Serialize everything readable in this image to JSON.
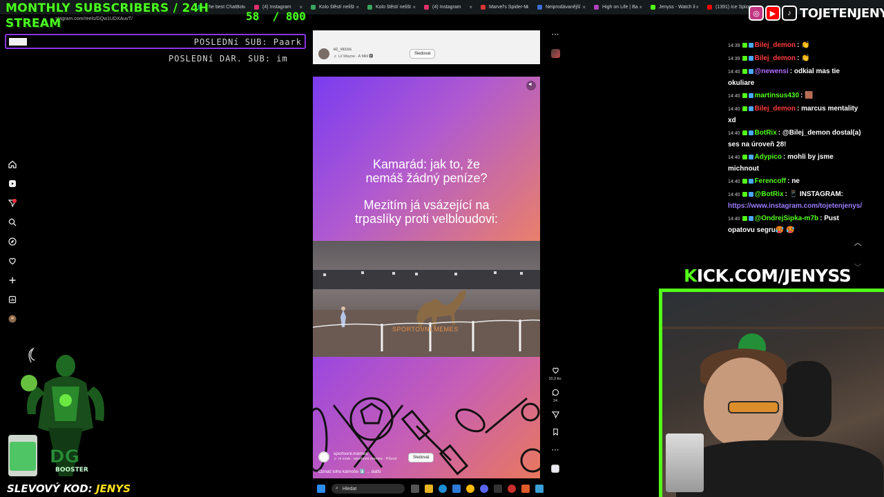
{
  "browser": {
    "tabs": [
      {
        "label": "The best ChatBot",
        "color": "#10a37f"
      },
      {
        "label": "(4) Instagram",
        "color": "#e1306c"
      },
      {
        "label": "Kolo štěstí nelišt",
        "color": "#3ba55d"
      },
      {
        "label": "Kolo štěstí nelišt",
        "color": "#3ba55d"
      },
      {
        "label": "(4) Instagram",
        "color": "#e1306c"
      },
      {
        "label": "Marvel's Spider-M",
        "color": "#d93636"
      },
      {
        "label": "Neiprodávanější",
        "color": "#3a6fd8"
      },
      {
        "label": "High on Life | Ba",
        "color": "#b040c0"
      },
      {
        "label": "Jenyss - Watch li",
        "color": "#53fc18"
      },
      {
        "label": "(1391) Ice Spice",
        "color": "#ff0000"
      }
    ],
    "address": "stagram.com/reels/DQw1UDXAuvT/"
  },
  "overlay": {
    "title_line1": "MONTHLY SUBSCRIBERS / 24H",
    "title_line2": "STREAM",
    "sub_count": "58  / 800",
    "last_sub": "POSLEDNí SUB: Paark",
    "last_gift": "POSLEDNí DAR. SUB: im",
    "discount_prefix": "SLEVOVÝ KOD:",
    "discount_code": "JENYS",
    "mascot_label": "BOOSTER",
    "kick_k": "K",
    "kick_rest": "ICK.COM/JENYSS",
    "social_handle": "TOJETENJENYS"
  },
  "instagram": {
    "nav_icons": [
      "home-icon",
      "reels-icon",
      "messages-icon",
      "search-icon",
      "explore-icon",
      "heart-icon",
      "plus-icon",
      "dashboard-icon",
      "profile-avatar"
    ],
    "top_reel": {
      "user": "ez_viccss",
      "song": "♬  Lil Wayne - A Milli 🅴",
      "follow": "Sledovat"
    },
    "main_reel": {
      "text_line1": "Kamarád: jak to, že nemáš žádný peníze?",
      "text_line2": "Mezitím já vsázející na trpaslíky proti velbloudovi:",
      "watermark": "SPORTOVNI.MEMES",
      "user": "sportovni.memes",
      "audio": "♬  ni zvuk  ·  sportovni.memes · Původ",
      "follow": "Sledovat",
      "caption": "Označ toho kámoše ⬇️ ... další"
    },
    "actions": {
      "likes": "10,3 tis.",
      "comments": "24"
    }
  },
  "chat": [
    {
      "time": "14:39",
      "user": "Bilej_demon",
      "color": "#ff3b3b",
      "text": ": 👏"
    },
    {
      "time": "14:39",
      "user": "Bilej_demon",
      "color": "#ff3b3b",
      "text": ": 👏"
    },
    {
      "time": "14:40",
      "user": "@newensi",
      "color": "#b06cff",
      "text": ": odkial mas tie okuliare"
    },
    {
      "time": "14:40",
      "user": "martinsus430",
      "color": "#53fc18",
      "text": ": 🟫"
    },
    {
      "time": "14:40",
      "user": "Bilej_demon",
      "color": "#ff3b3b",
      "text": ": marcus mentality xd"
    },
    {
      "time": "14:40",
      "user": "BotRix",
      "color": "#53fc18",
      "text": ": @Bilej_demon dostal(a) ses na úroveň 28!"
    },
    {
      "time": "14:40",
      "user": "Adypico",
      "color": "#53fc18",
      "text": ": mohli by jsme michnout"
    },
    {
      "time": "14:40",
      "user": "Ferencoff",
      "color": "#53fc18",
      "text": ": ne"
    },
    {
      "time": "14:40",
      "user": "@BotRix",
      "color": "#53fc18",
      "text": ": 📱 INSTAGRAM:",
      "link": "https://www.instagram.com/tojetenjenys/"
    },
    {
      "time": "14:40",
      "user": "@OndrejSipka-m7b",
      "color": "#53fc18",
      "text": ": Pust opatovu segru🥵 🥵"
    }
  ],
  "taskbar": {
    "search_placeholder": "Hledat"
  }
}
